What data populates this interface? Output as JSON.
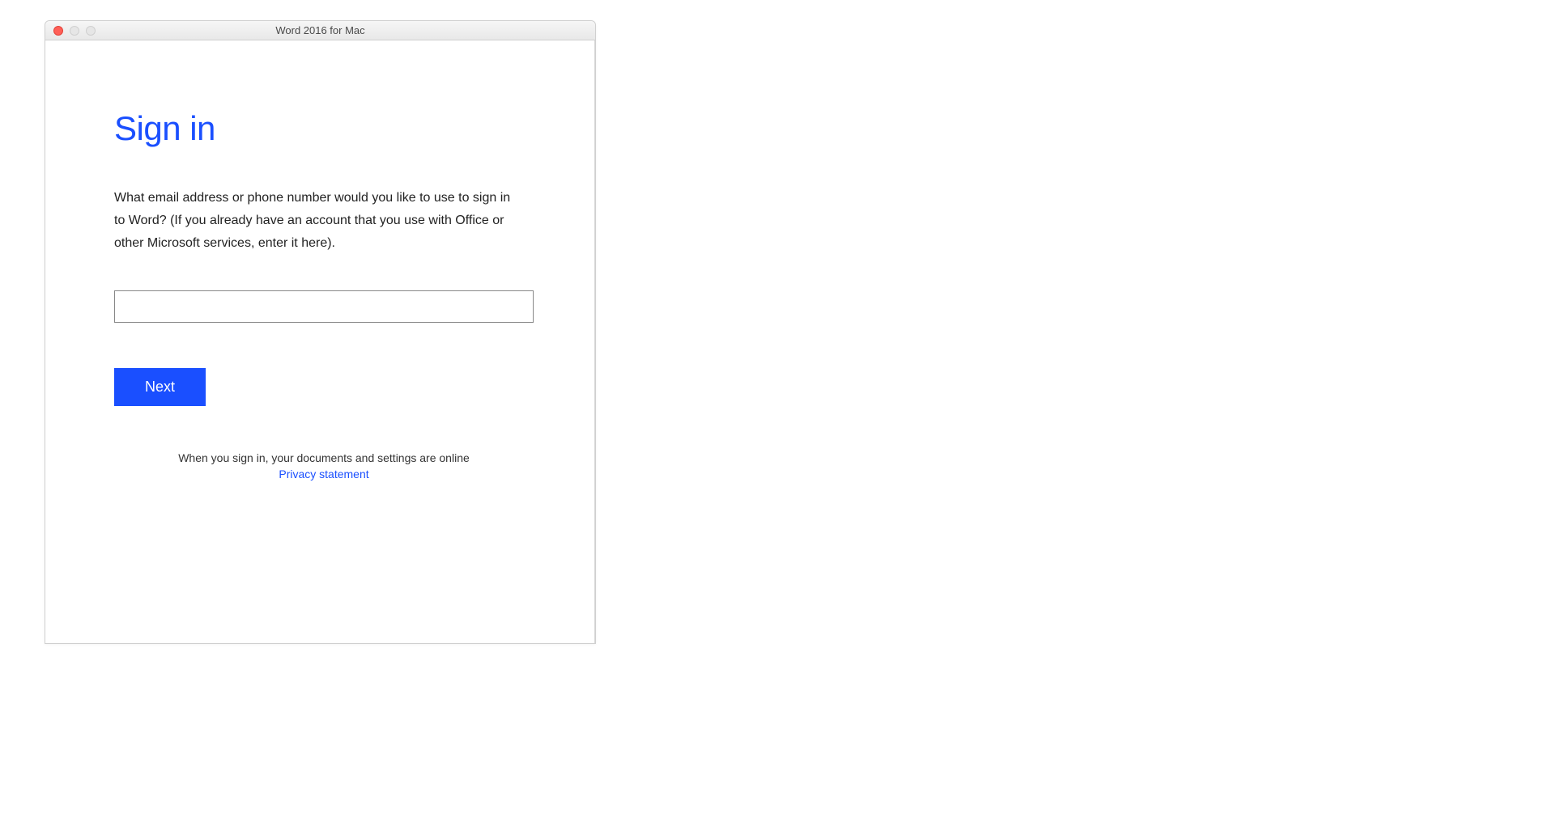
{
  "window": {
    "title": "Word 2016 for Mac"
  },
  "signin": {
    "heading": "Sign in",
    "description": "What email address or phone number would you like to use to sign in to Word? (If you already have an account that you use with Office or other Microsoft services, enter it here).",
    "email_value": "",
    "email_placeholder": "",
    "next_button": "Next",
    "footer_note": "When you sign in, your documents and settings are online",
    "privacy_link": "Privacy statement"
  },
  "colors": {
    "accent": "#1a4fff",
    "text": "#222222"
  }
}
